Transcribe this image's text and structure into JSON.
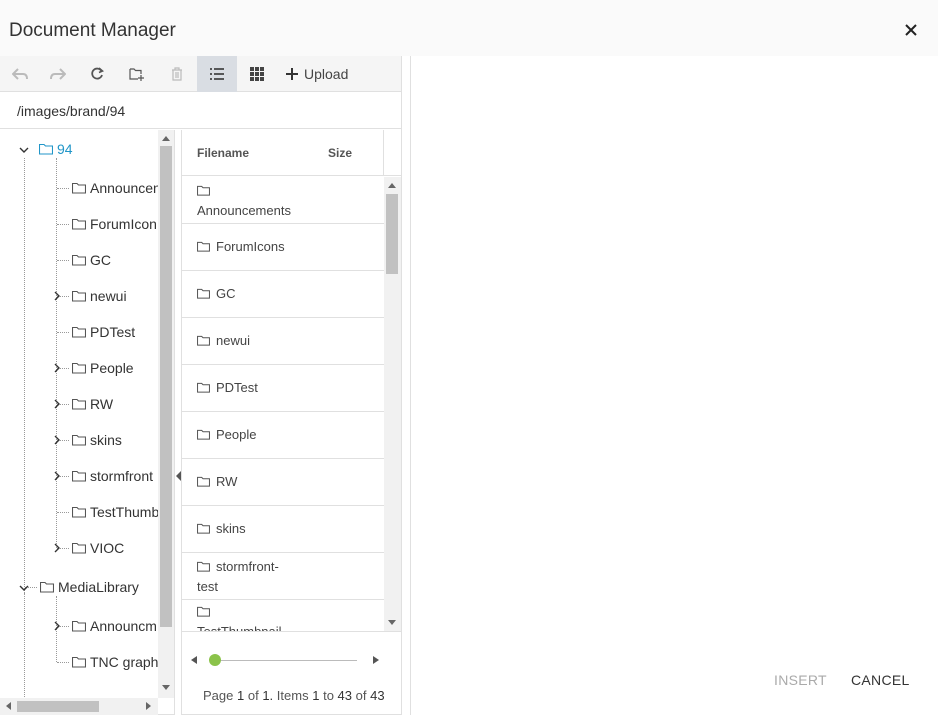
{
  "dialog": {
    "title": "Document Manager"
  },
  "toolbar": {
    "upload_label": "Upload"
  },
  "path": "/images/brand/94",
  "tree": {
    "root_selected": "94",
    "children": [
      "Announcen",
      "ForumIcon",
      "GC",
      "newui",
      "PDTest",
      "People",
      "RW",
      "skins",
      "stormfront",
      "TestThumb",
      "VIOC"
    ],
    "media_library": "MediaLibrary",
    "media_children": [
      "Announcm",
      "TNC graph"
    ]
  },
  "grid": {
    "columns": {
      "filename": "Filename",
      "size": "Size"
    },
    "rows": [
      {
        "lines": [
          "",
          "Announcements"
        ]
      },
      {
        "lines": [
          "ForumIcons"
        ]
      },
      {
        "lines": [
          "GC"
        ]
      },
      {
        "lines": [
          "newui"
        ]
      },
      {
        "lines": [
          "PDTest"
        ]
      },
      {
        "lines": [
          "People"
        ]
      },
      {
        "lines": [
          "RW"
        ]
      },
      {
        "lines": [
          "skins"
        ]
      },
      {
        "lines": [
          "stormfront-",
          "test"
        ]
      },
      {
        "lines": [
          "",
          "TestThumbnail"
        ]
      }
    ]
  },
  "pager": {
    "page_word": "Page",
    "page": "1",
    "of_word": "of",
    "pages": "1.",
    "items_word": "Items",
    "from": "1",
    "to_word": "to",
    "to": "43",
    "of_word2": "of",
    "total": "43"
  },
  "footer": {
    "insert_label": "INSERT",
    "cancel_label": "CANCEL"
  },
  "colors": {
    "selected": "#2196c8",
    "slider": "#8bc34a",
    "active_tool": "#d9dde3"
  }
}
